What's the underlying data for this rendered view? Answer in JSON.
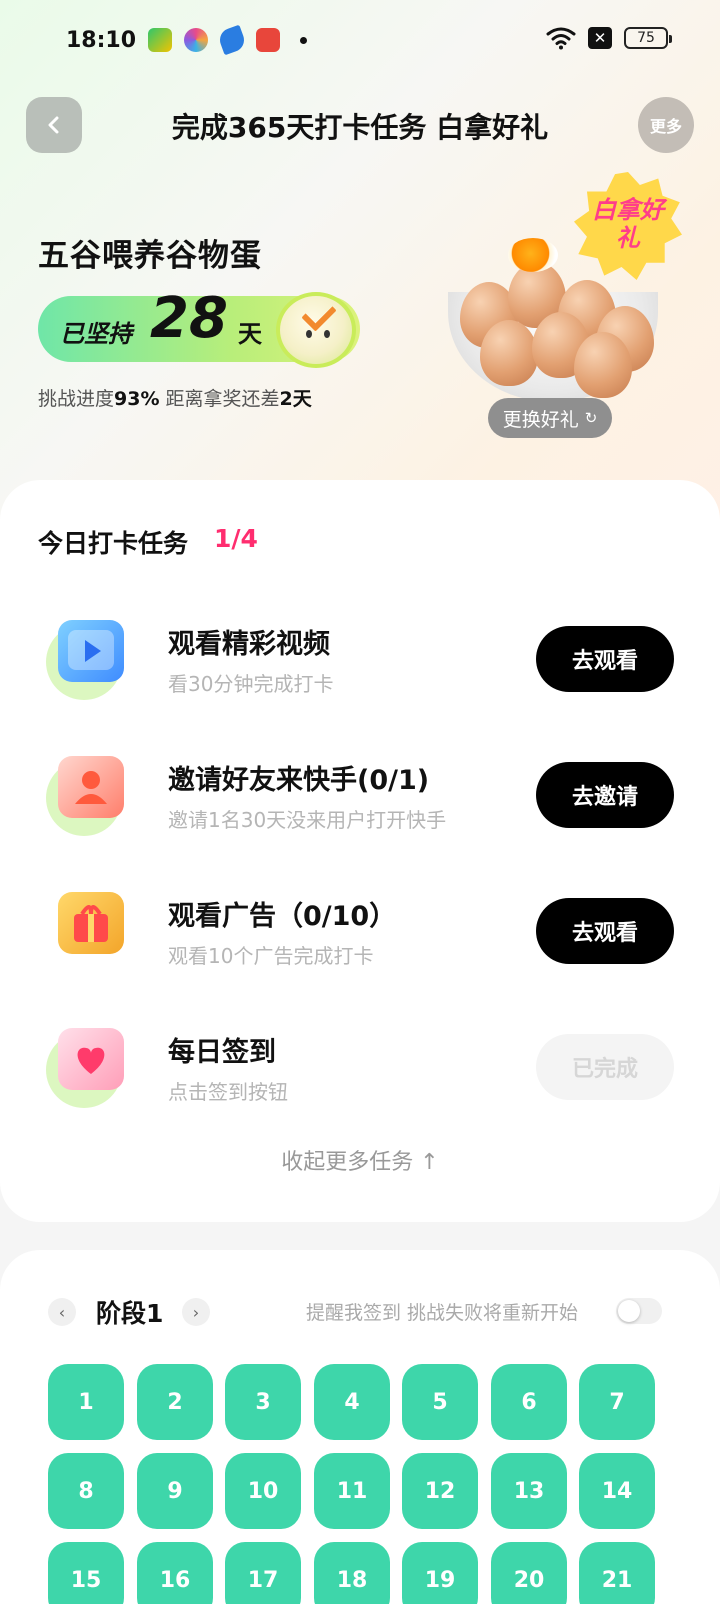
{
  "status_bar": {
    "time": "18:10",
    "battery": "75",
    "icons": [
      "app-icon-1",
      "app-icon-2",
      "app-icon-3",
      "app-icon-4",
      "notification-dot",
      "wifi-icon",
      "x-icon",
      "battery-icon"
    ]
  },
  "header": {
    "title": "完成365天打卡任务 白拿好礼",
    "more_label": "更多",
    "back_icon": "chevron-left-icon"
  },
  "hero": {
    "product_name": "五谷喂养谷物蛋",
    "streak_label": "已坚持",
    "streak_days": "28",
    "streak_unit": "天",
    "progress_prefix": "挑战进度",
    "progress_percent": "93%",
    "remaining_prefix": " 距离拿奖还差",
    "remaining_days": "2天",
    "badge_text": "白拿好礼",
    "change_gift_label": "更换好礼"
  },
  "tasks": {
    "title": "今日打卡任务",
    "count": "1/4",
    "items": [
      {
        "name": "观看精彩视频",
        "desc": "看30分钟完成打卡",
        "button": "去观看",
        "done": false,
        "icon": "video-play-icon"
      },
      {
        "name": "邀请好友来快手(0/1)",
        "desc": "邀请1名30天没来用户打开快手",
        "button": "去邀请",
        "done": false,
        "icon": "invite-user-icon"
      },
      {
        "name": "观看广告（0/10）",
        "desc": "观看10个广告完成打卡",
        "button": "去观看",
        "done": false,
        "icon": "gift-ad-icon"
      },
      {
        "name": "每日签到",
        "desc": "点击签到按钮",
        "button": "已完成",
        "done": true,
        "icon": "calendar-heart-icon"
      }
    ],
    "collapse_label": "收起更多任务 ↑"
  },
  "stage": {
    "title": "阶段1",
    "remind_label": "提醒我签到 挑战失败将重新开始",
    "days": [
      "1",
      "2",
      "3",
      "4",
      "5",
      "6",
      "7",
      "8",
      "9",
      "10",
      "11",
      "12",
      "13",
      "14",
      "15",
      "16",
      "17",
      "18",
      "19",
      "20",
      "21"
    ],
    "colors": {
      "day_cell": "#3ed6aa",
      "accent_count": "#ff2d6f"
    }
  }
}
